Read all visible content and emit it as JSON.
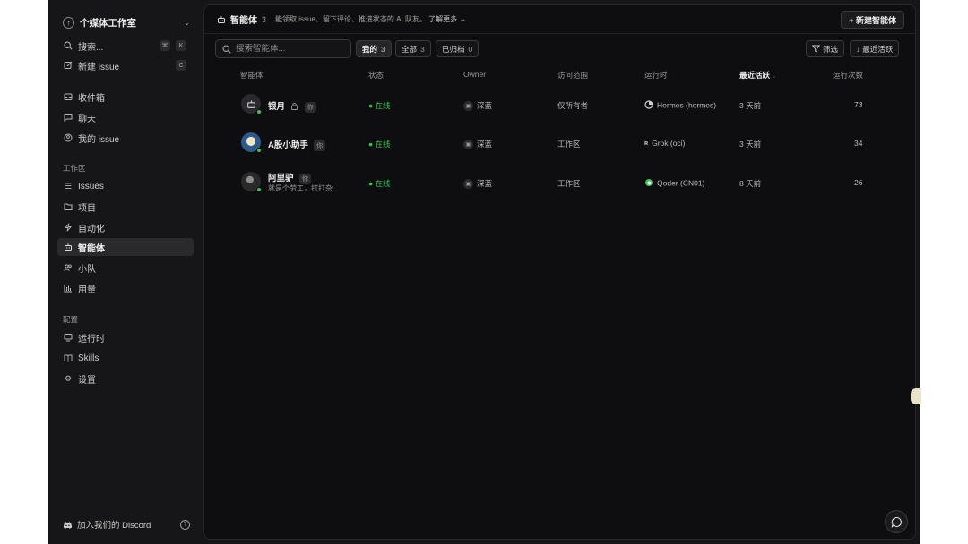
{
  "sidebar": {
    "workspace": "个媒体工作室",
    "search_label": "搜索...",
    "search_kbd": [
      "⌘",
      "K"
    ],
    "new_issue_label": "新建 issue",
    "new_issue_kbd": "C",
    "group1": [
      {
        "label": "收件箱",
        "icon": "inbox-icon"
      },
      {
        "label": "聊天",
        "icon": "chat-icon"
      },
      {
        "label": "我的 issue",
        "icon": "user-circle-icon"
      }
    ],
    "workspace_section": "工作区",
    "workspace_items": [
      {
        "label": "Issues",
        "icon": "issues-icon"
      },
      {
        "label": "项目",
        "icon": "folder-icon"
      },
      {
        "label": "自动化",
        "icon": "lightning-icon"
      },
      {
        "label": "智能体",
        "icon": "robot-icon"
      },
      {
        "label": "小队",
        "icon": "team-icon"
      },
      {
        "label": "用量",
        "icon": "bar-chart-icon"
      }
    ],
    "config_section": "配置",
    "config_items": [
      {
        "label": "运行时",
        "icon": "monitor-icon"
      },
      {
        "label": "Skills",
        "icon": "book-icon"
      },
      {
        "label": "设置",
        "icon": "gear-icon"
      }
    ],
    "discord_label": "加入我们的 Discord"
  },
  "header": {
    "title": "智能体",
    "count": "3",
    "description": "能领取 issue、留下评论、推进状态的 AI 队友。",
    "learn_more": "了解更多 →",
    "new_button": "+ 新建智能体"
  },
  "toolbar": {
    "search_placeholder": "搜索智能体...",
    "tabs": [
      {
        "label": "我的",
        "count": "3",
        "active": true
      },
      {
        "label": "全部",
        "count": "3",
        "active": false
      },
      {
        "label": "已归档",
        "count": "0",
        "active": false
      }
    ],
    "filter_label": "筛选",
    "sort_label": "最近活跃"
  },
  "table": {
    "columns": [
      "智能体",
      "状态",
      "Owner",
      "访问范围",
      "运行时",
      "最近活跃 ↓",
      "运行次数"
    ],
    "rows": [
      {
        "name": "银月",
        "tag": "你",
        "subtitle": "",
        "status": "● 在线",
        "owner": "深蓝",
        "access": "仅所有者",
        "runtime": "Hermes (hermes)",
        "last_active": "3 天前",
        "runs": "73"
      },
      {
        "name": "A股小助手",
        "tag": "你",
        "subtitle": "",
        "status": "● 在线",
        "owner": "深蓝",
        "access": "工作区",
        "runtime": "Grok (oci)",
        "last_active": "3 天前",
        "runs": "34"
      },
      {
        "name": "阿里驴",
        "tag": "你",
        "subtitle": "就是个劳工，打打杂",
        "status": "● 在线",
        "owner": "深蓝",
        "access": "工作区",
        "runtime": "Qoder (CN01)",
        "last_active": "8 天前",
        "runs": "26"
      }
    ]
  },
  "colors": {
    "online": "#3fbf5a",
    "background": "#0e0e10",
    "sidebar": "#161618"
  }
}
